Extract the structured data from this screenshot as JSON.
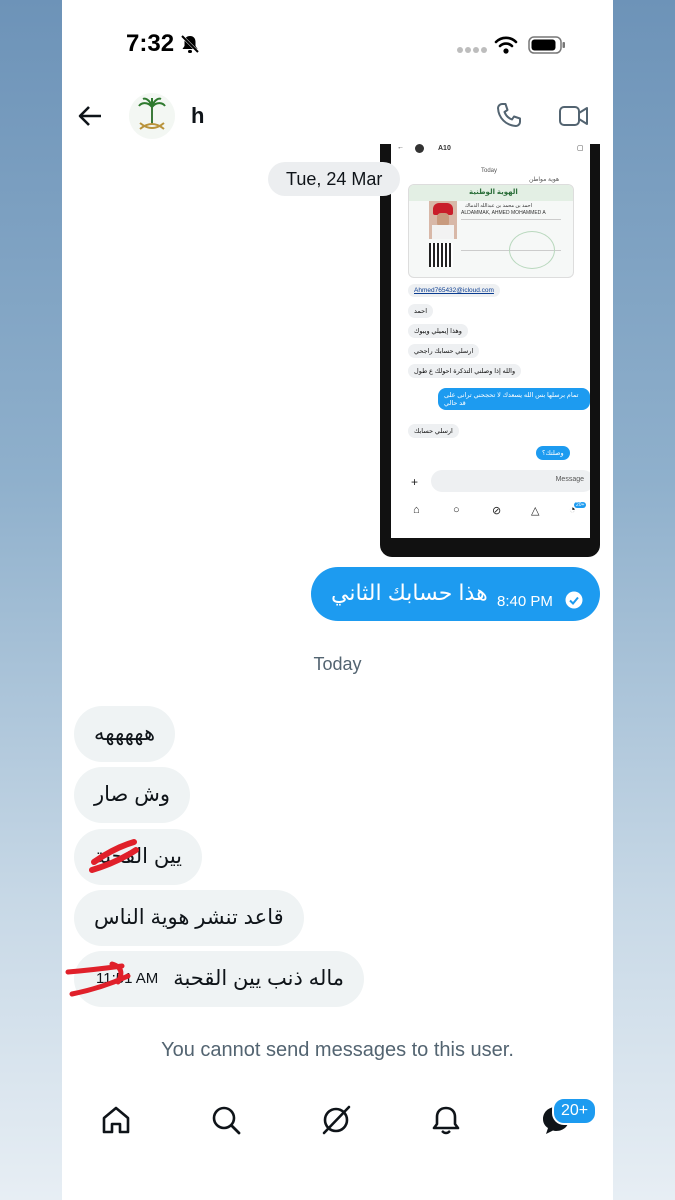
{
  "status_bar": {
    "time": "7:32"
  },
  "header": {
    "contact_name": "h"
  },
  "date_separator": "Tue, 24 Mar",
  "attachment": {
    "top_name": "A10",
    "day_label": "Today",
    "card_header": "هوية مواطن",
    "card_title": "الهوية الوطنية",
    "card_name_ar": "احمد بن محمد بن عبدالله الدماك",
    "card_name_en": "ALDAMMAK, AHMED MOHAMMED A",
    "messages": [
      {
        "text": "Ahmed765432@icloud.com"
      },
      {
        "text": "احمد"
      },
      {
        "text": "وهذا إيميلي ويبوك"
      },
      {
        "text": "ارسلي حسابك راجحي"
      },
      {
        "text": "والله إذا وصلني التذكرة احولك ع طول"
      },
      {
        "text": "تمام برسلها بس الله يسعدك لا تحجحني ترانى على قد حالي"
      },
      {
        "text": "ارسلي حسابك"
      },
      {
        "text": "وصلتك؟"
      }
    ],
    "input_placeholder": "Message",
    "badge": "20+"
  },
  "outgoing": {
    "text": "هذا حسابك الثاني",
    "time": "8:40 PM"
  },
  "today_label": "Today",
  "incoming": [
    {
      "text": "هههههه"
    },
    {
      "text": "وش صار"
    },
    {
      "text": "يين القحبة"
    },
    {
      "text": "قاعد تنشر هوية الناس"
    },
    {
      "text": "ماله ذنب يين القحبة",
      "time": "11:51 AM"
    }
  ],
  "notice": "You cannot send messages to this user.",
  "bottom_nav": {
    "items": [
      "home-icon",
      "search-icon",
      "grok-icon",
      "notifications-icon",
      "messages-icon"
    ],
    "badge": "20+"
  },
  "colors": {
    "accent": "#1d9bf0",
    "bubble_in": "#eff3f4",
    "muted": "#536471"
  }
}
